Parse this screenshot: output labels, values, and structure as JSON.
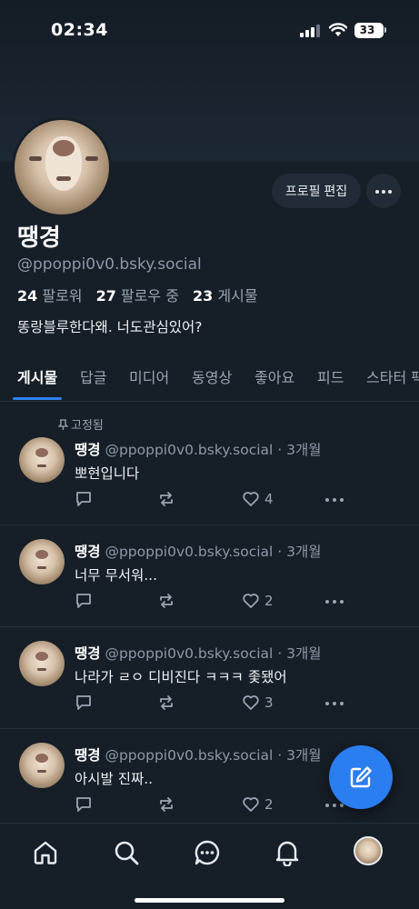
{
  "status_bar": {
    "time": "02:34",
    "battery": "33"
  },
  "profile": {
    "display_name": "땡경",
    "handle": "@ppoppi0v0.bsky.social",
    "followers_count": "24",
    "followers_label": "팔로워",
    "following_count": "27",
    "following_label": "팔로우 중",
    "posts_count": "23",
    "posts_label": "게시물",
    "bio": "똥랑블루한다왜. 너도관심있어?",
    "edit_button": "프로필 편집"
  },
  "tabs": [
    "게시물",
    "답글",
    "미디어",
    "동영상",
    "좋아요",
    "피드",
    "스타터 팩"
  ],
  "pinned_label": "고정됨",
  "posts": [
    {
      "author": "땡경",
      "meta": "@ppoppi0v0.bsky.social · 3개월",
      "text": "뽀현입니다",
      "likes": "4"
    },
    {
      "author": "땡경",
      "meta": "@ppoppi0v0.bsky.social · 3개월",
      "text": "너무 무서워...",
      "likes": "2"
    },
    {
      "author": "땡경",
      "meta": "@ppoppi0v0.bsky.social · 3개월",
      "text": "나라가 ㄹㅇ 디비진다 ㅋㅋㅋ 좇됐어",
      "likes": "3"
    },
    {
      "author": "땡경",
      "meta": "@ppoppi0v0.bsky.social · 3개월",
      "text": "아시발 진짜..",
      "likes": "2"
    }
  ],
  "colors": {
    "background": "#161e27",
    "accent": "#2d82f3",
    "fab": "#2b7ef0",
    "muted_text": "#8d9aa8"
  },
  "icons": {
    "bottom_nav": [
      "home-icon",
      "search-icon",
      "chat-icon",
      "bell-icon",
      "avatar"
    ],
    "post_actions": [
      "reply-icon",
      "repost-icon",
      "heart-icon",
      "more-icon"
    ],
    "fab": "compose-icon"
  }
}
